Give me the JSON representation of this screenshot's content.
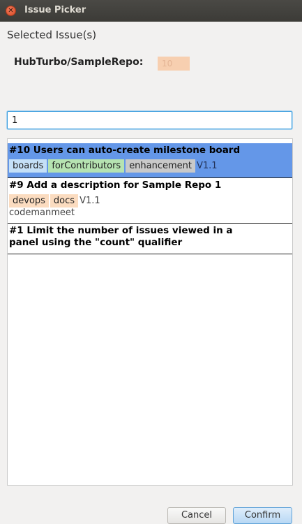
{
  "window": {
    "title": "Issue Picker"
  },
  "selected_section": {
    "label": "Selected Issue(s)",
    "repo": "HubTurbo/SampleRepo:",
    "selected_issue": "10"
  },
  "search": {
    "value": "1"
  },
  "issues": [
    {
      "title": "#10 Users can auto-create milestone board",
      "labels": [
        {
          "text": "boards",
          "color": "#c5e0f7"
        },
        {
          "text": "forContributors",
          "color": "#b6e3b1"
        },
        {
          "text": "enhancement",
          "color": "#c9c9c9"
        }
      ],
      "milestone": "V1.1",
      "assignee": "",
      "selected": true
    },
    {
      "title": "#9 Add a description for Sample Repo 1",
      "labels": [
        {
          "text": "devops",
          "color": "#fbdcc0"
        },
        {
          "text": "docs",
          "color": "#fbdcc0"
        }
      ],
      "milestone": "V1.1",
      "assignee": "codemanmeet",
      "selected": false
    },
    {
      "title": "#1 Limit the number of issues viewed in a\npanel using the \"count\" qualifier",
      "labels": [],
      "milestone": "",
      "assignee": "",
      "selected": false
    }
  ],
  "buttons": {
    "cancel": "Cancel",
    "confirm": "Confirm"
  },
  "colors": {
    "selection": "#6497e8",
    "focus": "#3d9ede",
    "chip": "#f7cfb0"
  }
}
